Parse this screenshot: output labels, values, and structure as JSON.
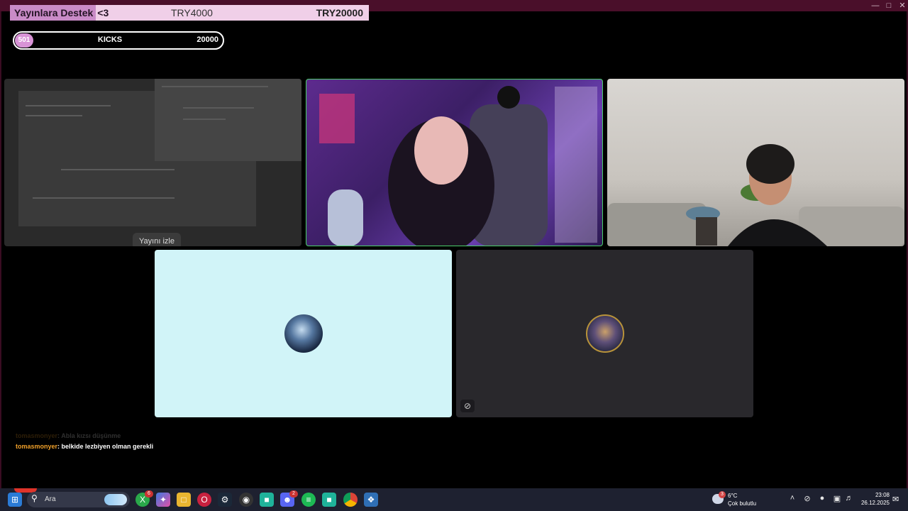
{
  "donation": {
    "label": "Yayınlara Destek",
    "heart": "<3",
    "amount": "TRY4000",
    "goal": "TRY20000"
  },
  "kicks": {
    "badge": "501",
    "label": "KICKS",
    "value": "20000"
  },
  "tiles": {
    "screen_share": {
      "watch_label": "Yayını izle"
    }
  },
  "chat": {
    "messages": [
      {
        "user": "tomasmonyer",
        "text": ": Abla kızsı düşünme"
      },
      {
        "user": "tomasmonyer",
        "text": ": belkide lezbiyen olman gerekli"
      }
    ]
  },
  "taskbar": {
    "search_placeholder": "Ara",
    "badges": {
      "xbox": "6",
      "discord": "2"
    },
    "weather": {
      "badge": "3",
      "temp": "6°C",
      "condition": "Çok bulutlu"
    },
    "clock": {
      "time": "23:08",
      "date": "26.12.2025"
    }
  },
  "colors": {
    "window_frame": "#4a0f2a",
    "donation_bg": "#f0cfe8",
    "donation_label_bg": "#c98bc7",
    "kicks_badge": "#d893d6",
    "active_speaker_border": "#4ad06a",
    "tile_light": "#d1f4f8",
    "tile_dark": "#29282c",
    "chat_user": "#f0a02a",
    "taskbar": "#1e2130"
  },
  "icons": {
    "window_controls": [
      "minimize-icon",
      "maximize-icon",
      "close-icon"
    ],
    "taskbar_apps": [
      "windows-start-icon",
      "search-icon",
      "xbox-icon",
      "copilot-icon",
      "file-explorer-icon",
      "opera-icon",
      "steam-icon",
      "obs-icon",
      "app-icon",
      "discord-icon",
      "spotify-icon",
      "app-icon",
      "chrome-icon",
      "app-icon"
    ],
    "tray": [
      "chevron-up-icon",
      "eye-off-icon",
      "microphone-icon",
      "network-icon",
      "speaker-icon",
      "notification-bell-icon"
    ]
  }
}
